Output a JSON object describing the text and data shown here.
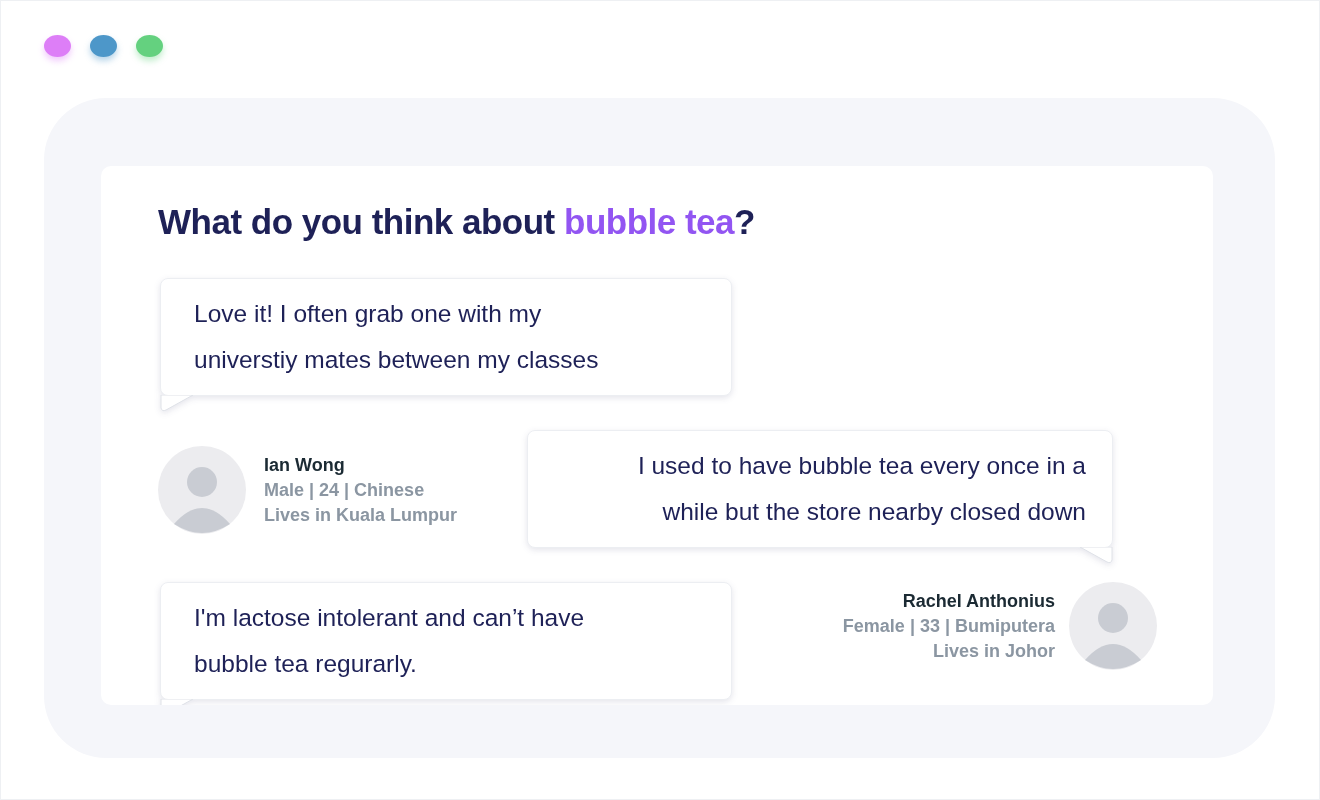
{
  "question": {
    "before": "What do you think about ",
    "highlight": "bubble tea",
    "after": "?"
  },
  "responses": [
    {
      "text": "Love it! I often grab one with my universtiy mates between my classes",
      "kind": "left",
      "respondent": {
        "name": "Ian Wong",
        "details": "Male | 24 | Chinese",
        "location": "Lives in Kuala Lumpur"
      }
    },
    {
      "text": "I used to have bubble tea every once in a while but the store nearby closed down",
      "kind": "right",
      "respondent": {
        "name": "Rachel Anthonius",
        "details": "Female | 33 | Bumiputera",
        "location": "Lives in Johor"
      }
    },
    {
      "text": "I'm lactose intolerant and can’t have bubble tea regurarly.",
      "kind": "left"
    }
  ]
}
